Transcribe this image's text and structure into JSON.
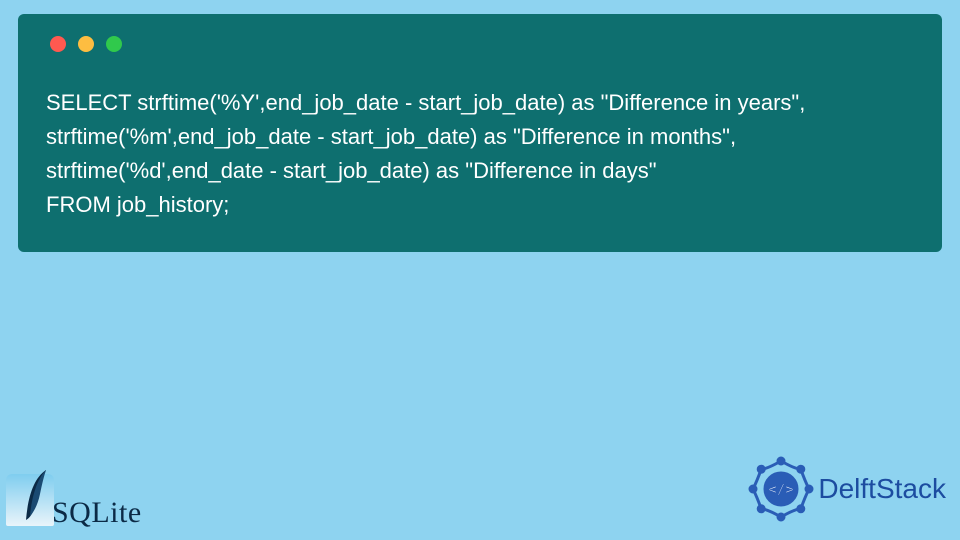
{
  "code": {
    "lines": [
      "SELECT strftime('%Y',end_job_date - start_job_date) as \"Difference in years\",",
      "strftime('%m',end_job_date - start_job_date) as \"Difference in months\",",
      "strftime('%d',end_date - start_job_date) as \"Difference in days\"",
      "FROM job_history;"
    ]
  },
  "logos": {
    "left": "SQLite",
    "right": "DelftStack"
  },
  "colors": {
    "page_bg": "#8ed3f0",
    "block_bg": "#0e6f6f",
    "dot_red": "#ff5950",
    "dot_yellow": "#fdbd41",
    "dot_green": "#30c94c",
    "delft_blue": "#1c4ca0"
  }
}
